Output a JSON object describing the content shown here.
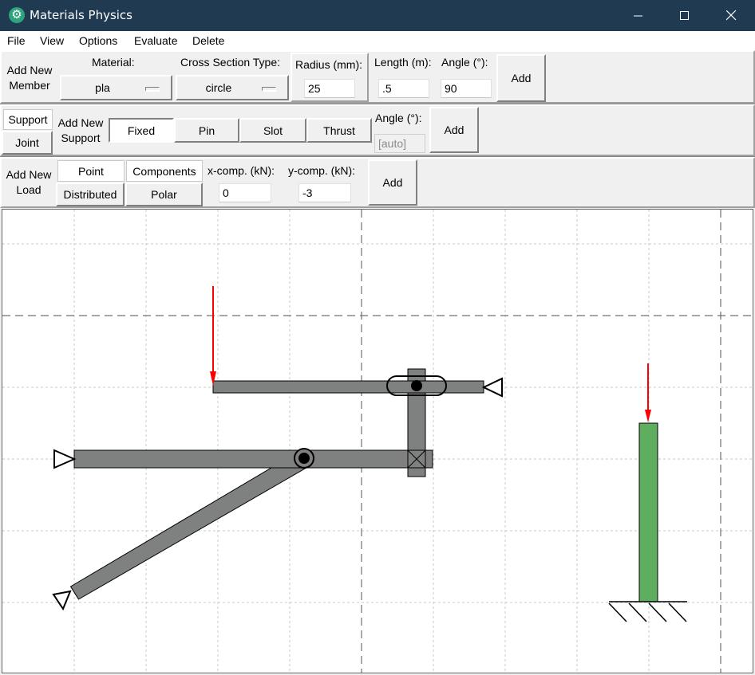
{
  "window": {
    "title": "Materials Physics",
    "app_icon": "gear-icon",
    "controls": [
      "minimize-icon",
      "maximize-icon",
      "close-icon"
    ]
  },
  "menu": [
    "File",
    "View",
    "Options",
    "Evaluate",
    "Delete"
  ],
  "member": {
    "heading": "Add New\nMember",
    "material_label": "Material:",
    "material_value": "pla",
    "cross_section_label": "Cross Section Type:",
    "cross_section_value": "circle",
    "radius_label": "Radius (mm):",
    "radius_value": "25",
    "length_label": "Length (m):",
    "length_value": ".5",
    "angle_label": "Angle (°):",
    "angle_value": "90",
    "add_label": "Add"
  },
  "support": {
    "mode_support": "Support",
    "mode_joint": "Joint",
    "heading": "Add New\nSupport",
    "types": [
      "Fixed",
      "Pin",
      "Slot",
      "Thrust"
    ],
    "selected_type": "Fixed",
    "angle_label": "Angle (°):",
    "angle_placeholder": "[auto]",
    "add_label": "Add"
  },
  "load": {
    "heading": "Add New\nLoad",
    "type_point": "Point",
    "type_distributed": "Distributed",
    "mode_components": "Components",
    "mode_polar": "Polar",
    "xcomp_label": "x-comp. (kN):",
    "xcomp_value": "0",
    "ycomp_label": "y-comp. (kN):",
    "ycomp_value": "-3",
    "add_label": "Add"
  },
  "colors": {
    "titlebar": "#203a52",
    "member": "#7f8080",
    "selected_member": "#5fae5f",
    "load": "#ff0000",
    "grid": "#c8c8c8"
  }
}
